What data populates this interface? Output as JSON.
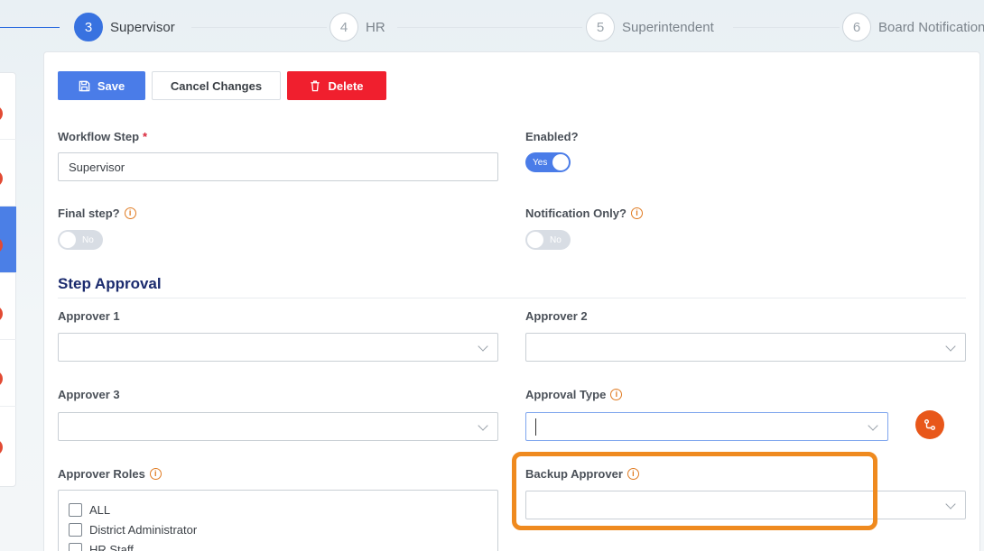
{
  "stepper": {
    "steps": [
      {
        "number": "3",
        "label": "Supervisor",
        "active": true
      },
      {
        "number": "4",
        "label": "HR",
        "active": false
      },
      {
        "number": "5",
        "label": "Superintendent",
        "active": false
      },
      {
        "number": "6",
        "label": "Board Notification",
        "active": false
      }
    ]
  },
  "toolbar": {
    "save_label": "Save",
    "cancel_label": "Cancel Changes",
    "delete_label": "Delete"
  },
  "form": {
    "workflow_step": {
      "label": "Workflow Step",
      "required_mark": "*",
      "value": "Supervisor"
    },
    "enabled": {
      "label": "Enabled?",
      "state": "Yes"
    },
    "final_step": {
      "label": "Final step?",
      "state": "No"
    },
    "notification_only": {
      "label": "Notification Only?",
      "state": "No"
    }
  },
  "step_approval": {
    "title": "Step Approval",
    "approver1": {
      "label": "Approver 1",
      "value": ""
    },
    "approver2": {
      "label": "Approver 2",
      "value": ""
    },
    "approver3": {
      "label": "Approver 3",
      "value": ""
    },
    "approval_type": {
      "label": "Approval Type",
      "value": ""
    },
    "approver_roles": {
      "label": "Approver Roles",
      "options": [
        "ALL",
        "District Administrator",
        "HR Staff"
      ]
    },
    "backup_approver": {
      "label": "Backup Approver",
      "value": ""
    }
  },
  "icons": {
    "info_glyph": "i"
  },
  "colors": {
    "primary": "#4a7ce8",
    "danger": "#f01f2e",
    "accent_orange": "#e8571a",
    "highlight": "#ef8a1f",
    "section_title": "#1b2b6e"
  }
}
